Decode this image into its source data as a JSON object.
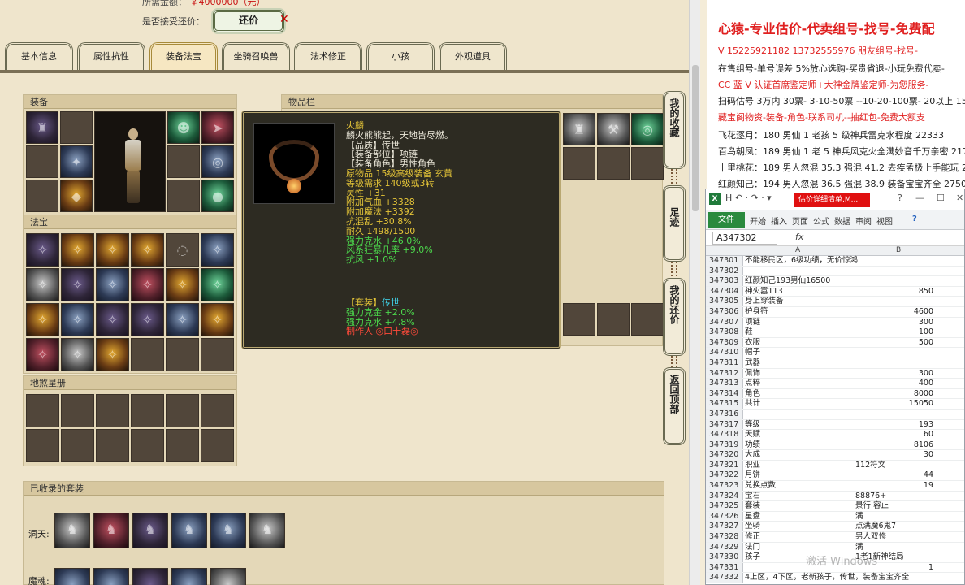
{
  "game": {
    "top_line_label": "所需金额：",
    "top_line_value": "￥4000000（元）",
    "accept_counter_label": "是否接受还价：",
    "counter_button": "还价",
    "tabs": [
      "基本信息",
      "属性抗性",
      "装备法宝",
      "坐骑召唤兽",
      "法术修正",
      "小孩",
      "外观道具"
    ],
    "active_tab": "装备法宝",
    "sections": {
      "equipment": "装备",
      "treasure": "法宝",
      "star_book": "地煞星册",
      "inventory": "物品栏",
      "collected_sets": "已收录的套装"
    },
    "collected": {
      "row1_label": "洞天:",
      "row2_label": "魔魂:"
    },
    "side_buttons": [
      {
        "label": "我的收藏"
      },
      {
        "label": "足迹"
      },
      {
        "label": "我的还价"
      },
      {
        "label": "返回顶部"
      }
    ],
    "tooltip": {
      "name": "火麟",
      "desc": "麟火熊熊起，天地皆尽燃。",
      "lines": [
        {
          "text": "【品质】传世",
          "color": "w"
        },
        {
          "text": "【装备部位】项链",
          "color": "w"
        },
        {
          "text": "【装备角色】男性角色",
          "color": "w"
        },
        {
          "text": "原物品 15级高级装备 玄黄",
          "color": "y"
        },
        {
          "text": "等级需求 140级或3转",
          "color": "y"
        },
        {
          "text": "灵性 +31",
          "color": "y"
        },
        {
          "text": "附加气血 +3328",
          "color": "y"
        },
        {
          "text": "附加魔法 +3392",
          "color": "y"
        },
        {
          "text": "抗混乱 +30.8%",
          "color": "y"
        },
        {
          "text": "耐久 1498/1500",
          "color": "y"
        },
        {
          "text": "强力克水 +46.0%",
          "color": "g"
        },
        {
          "text": "风系狂暴几率 +9.0%",
          "color": "g"
        },
        {
          "text": "抗风 +1.0%",
          "color": "g"
        }
      ],
      "set_title": "【套装】",
      "set_name": "传世",
      "set_lines": [
        {
          "text": "强力克金 +2.0%",
          "color": "g"
        },
        {
          "text": "强力克水 +4.8%",
          "color": "g"
        },
        {
          "text": "制作人 ◎口十磊◎",
          "color": "r"
        }
      ]
    }
  },
  "ad": {
    "headline": "心猿-专业估价-代卖组号-找号-免费配",
    "lines": [
      {
        "text": "V 15225921182  13732555976 朋友组号-找号-",
        "red": true
      },
      {
        "text": "在售组号-单号误差 5%放心选购-买贵省退-小玩免费代卖-",
        "red": false
      },
      {
        "text": "CC 蓝 V 认证首席鉴定师+大神金牌鉴定师-为您服务-",
        "red": true
      },
      {
        "text": "扫码估号 3万内 30票- 3-10-50票  --10-20-100票- 20以上 150",
        "red": false
      },
      {
        "text": "藏宝阁物资-装备-角色-联系司机--抽红包-免费大额支",
        "red": true
      },
      {
        "text": "飞花逐月：180 男仙 1 老孩 5 级神兵雷克水程度 22333",
        "red": false
      },
      {
        "text": "百鸟朝凤：189 男仙 1 老 5 神兵风克火全满妙音千万亲密 217",
        "red": false
      },
      {
        "text": "十里桃花：189 男人忽混 35.3 强混 41.2 去疾孟极上手能玩 2",
        "red": false
      },
      {
        "text": "红颜知己：194 男人忽混 36.5 强混 38.9 装备宝宝齐全 27500",
        "red": false
      }
    ]
  },
  "excel": {
    "quick_access": "H ↶ · ↷ · ▾",
    "filename": "估价详细清单.M...",
    "ribbon_file": "文件",
    "ribbon_tabs": [
      "开始",
      "插入",
      "页面",
      "公式",
      "数据",
      "审阅",
      "视图"
    ],
    "help": "?",
    "name_box": "A347302",
    "fx": "fx",
    "col_a": "A",
    "col_b": "B",
    "rows": [
      {
        "n": "347301",
        "a": "不能移民区，6级功绩，无价惊鸿",
        "b": ""
      },
      {
        "n": "347302",
        "a": "",
        "b": ""
      },
      {
        "n": "347303",
        "a": "红颜知己193男仙16500",
        "b": ""
      },
      {
        "n": "347304",
        "a": "神火嚣113",
        "b": "850"
      },
      {
        "n": "347305",
        "a": "身上穿装备",
        "b": ""
      },
      {
        "n": "347306",
        "a": "护身符",
        "b": "4600"
      },
      {
        "n": "347307",
        "a": "项链",
        "b": "300"
      },
      {
        "n": "347308",
        "a": "鞋",
        "b": "100"
      },
      {
        "n": "347309",
        "a": "衣服",
        "b": "500"
      },
      {
        "n": "347310",
        "a": "帽子",
        "b": ""
      },
      {
        "n": "347311",
        "a": "武器",
        "b": ""
      },
      {
        "n": "347312",
        "a": "佩饰",
        "b": "300"
      },
      {
        "n": "347313",
        "a": "点粹",
        "b": "400"
      },
      {
        "n": "347314",
        "a": "角色",
        "b": "8000"
      },
      {
        "n": "347315",
        "a": "共计",
        "b": "15050"
      },
      {
        "n": "347316",
        "a": "",
        "b": ""
      },
      {
        "n": "347317",
        "a": "等级",
        "b": "193"
      },
      {
        "n": "347318",
        "a": "天赋",
        "b": "60"
      },
      {
        "n": "347319",
        "a": "功绩",
        "b": "8106"
      },
      {
        "n": "347320",
        "a": "大成",
        "b": "30"
      },
      {
        "n": "347321",
        "a": "职业",
        "bt": "112符文"
      },
      {
        "n": "347322",
        "a": "月饼",
        "b": "44"
      },
      {
        "n": "347323",
        "a": "兑换点数",
        "b": "19"
      },
      {
        "n": "347324",
        "a": "宝石",
        "bt": "88876+"
      },
      {
        "n": "347325",
        "a": "套装",
        "bt": "景行 容止"
      },
      {
        "n": "347326",
        "a": "星盘",
        "bt": "满"
      },
      {
        "n": "347327",
        "a": "坐骑",
        "bt": "点满魔6鬼7"
      },
      {
        "n": "347328",
        "a": "修正",
        "bt": "男人双修"
      },
      {
        "n": "347329",
        "a": "法门",
        "bt": "满"
      },
      {
        "n": "347330",
        "a": "孩子",
        "bt": "1老1新神结局"
      },
      {
        "n": "347331",
        "a": "",
        "b": "1"
      },
      {
        "n": "347332",
        "a": "4上区，4下区，老新孩子，传世，装备宝宝齐全",
        "b": ""
      }
    ],
    "watermark": "激活 Windows"
  }
}
